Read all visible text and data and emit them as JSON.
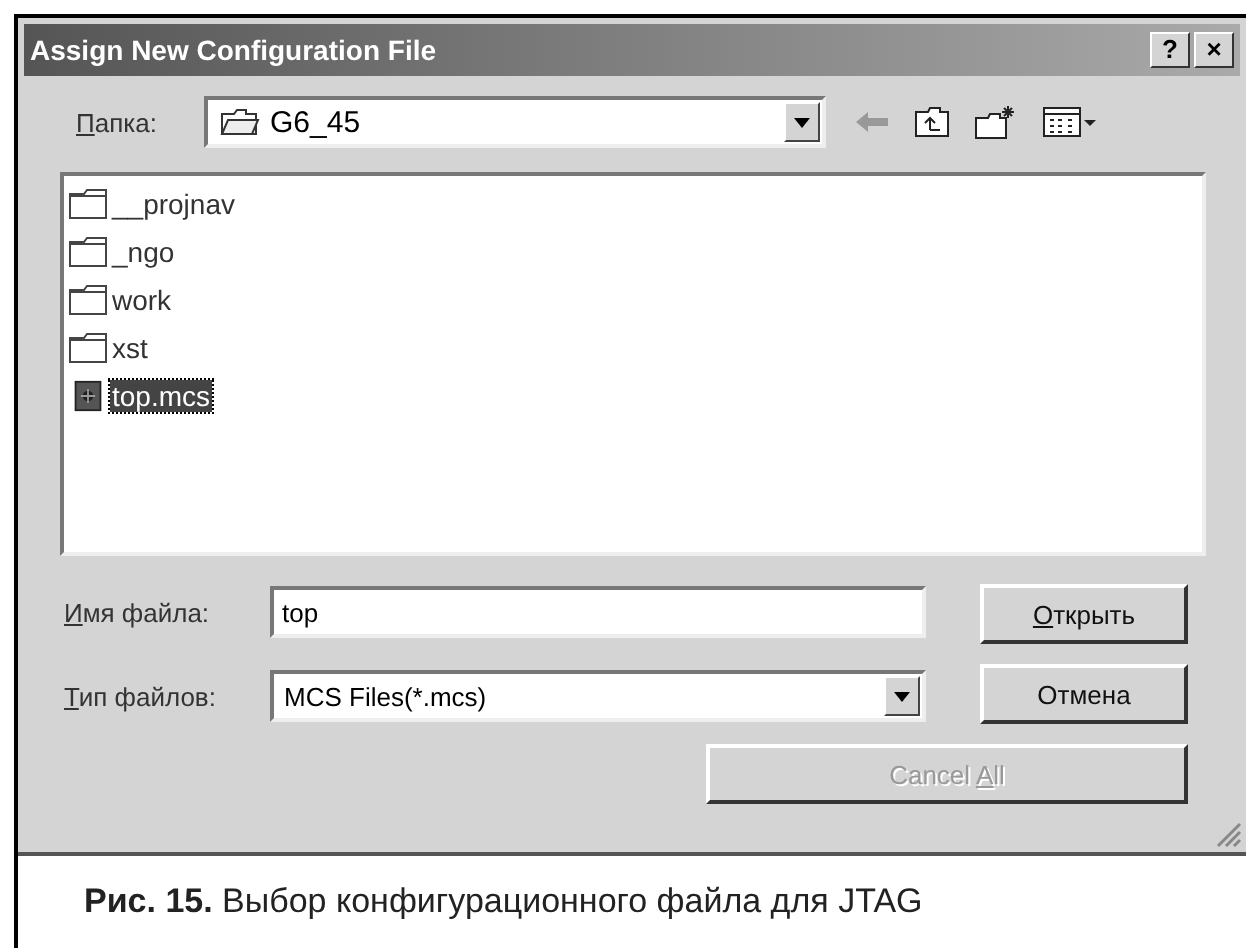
{
  "window": {
    "title": "Assign New Configuration File",
    "title_buttons": [
      "?",
      "×"
    ]
  },
  "folder_bar": {
    "label": {
      "accel": "П",
      "after": "апка:"
    },
    "value": "G6_45"
  },
  "files": [
    {
      "name": "__projnav",
      "kind": "folder",
      "selected": false
    },
    {
      "name": "_ngo",
      "kind": "folder",
      "selected": false
    },
    {
      "name": "work",
      "kind": "folder",
      "selected": false
    },
    {
      "name": "xst",
      "kind": "folder",
      "selected": false
    },
    {
      "name": "top.mcs",
      "kind": "file",
      "selected": true
    }
  ],
  "file_name": {
    "label": {
      "accel": "И",
      "after": "мя файла:"
    },
    "value": "top"
  },
  "file_type": {
    "label": {
      "accel": "Т",
      "after": "ип файлов:"
    },
    "value": "MCS Files(*.mcs)"
  },
  "buttons": [
    {
      "label": {
        "accel": "О",
        "after": "ткрыть"
      },
      "disabled": false
    },
    {
      "label": {
        "before": "Отмена"
      },
      "disabled": false
    },
    {
      "label": {
        "before": "Cancel ",
        "accel": "A",
        "after": "ll"
      },
      "disabled": true
    }
  ],
  "caption": "**Рис. 15.** Выбор конфигурационного файла для JTAG"
}
